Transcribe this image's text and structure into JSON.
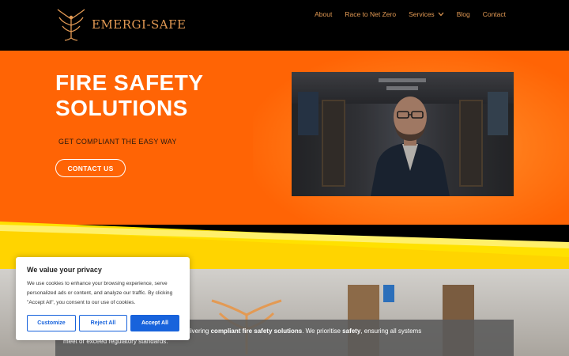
{
  "header": {
    "brand": "EMERGI-SAFE",
    "nav": [
      {
        "label": "About",
        "has_dropdown": false
      },
      {
        "label": "Race to Net Zero",
        "has_dropdown": false
      },
      {
        "label": "Services",
        "has_dropdown": true
      },
      {
        "label": "Blog",
        "has_dropdown": false
      },
      {
        "label": "Contact",
        "has_dropdown": false
      }
    ]
  },
  "hero": {
    "title": "FIRE SAFETY SOLUTIONS",
    "subtitle": "GET COMPLIANT THE EASY WAY",
    "cta": "CONTACT US"
  },
  "intro": {
    "part1": "e our commitment to delivering ",
    "bold1": "compliant fire safety solutions",
    "part2": ". We prioritise ",
    "bold2": "safety",
    "part3": ", ensuring all systems",
    "line2": "meet or exceed regulatory standards."
  },
  "cookie": {
    "title": "We value your privacy",
    "text": "We use cookies to enhance your browsing experience, serve personalized ads or content, and analyze our traffic. By clicking \"Accept All\", you consent to our use of cookies.",
    "customize": "Customize",
    "reject": "Reject All",
    "accept": "Accept All"
  },
  "colors": {
    "brand_accent": "#e39a54",
    "hero_bg": "#ff6405",
    "band_yellow": "#ffd400",
    "cookie_primary": "#1863dc"
  }
}
